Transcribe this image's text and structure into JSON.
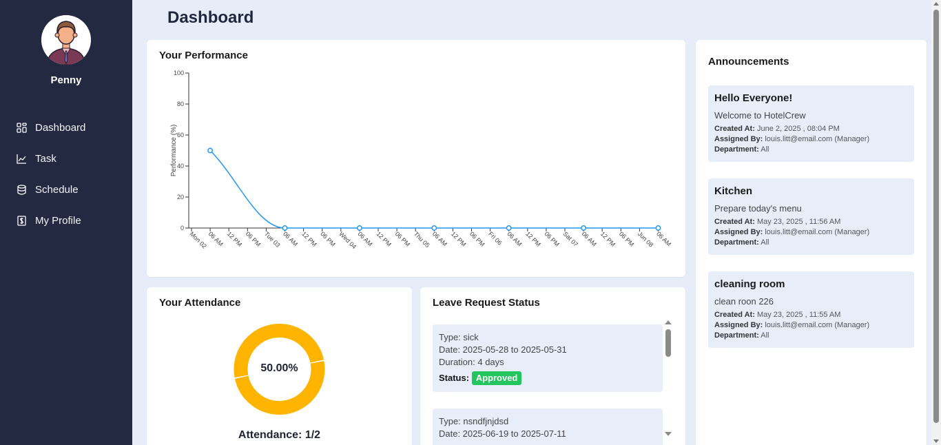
{
  "user": {
    "name": "Penny"
  },
  "sidebar": {
    "items": [
      {
        "label": "Dashboard",
        "icon": "grid-icon"
      },
      {
        "label": "Task",
        "icon": "chart-line-icon"
      },
      {
        "label": "Schedule",
        "icon": "database-icon"
      },
      {
        "label": "My Profile",
        "icon": "dollar-file-icon"
      }
    ]
  },
  "page": {
    "title": "Dashboard"
  },
  "performance": {
    "title": "Your Performance",
    "chart_data": {
      "type": "line",
      "title": "Your Performance",
      "xlabel": "",
      "ylabel": "Performance (%)",
      "ylim": [
        0,
        100
      ],
      "yticks": [
        "0",
        "20",
        "40",
        "60",
        "80",
        "100"
      ],
      "xticks": [
        "Mon 02",
        "06 AM",
        "12 PM",
        "06 PM",
        "Tue 03",
        "06 AM",
        "12 PM",
        "06 PM",
        "Wed 04",
        "06 AM",
        "12 PM",
        "06 PM",
        "Thu 05",
        "06 AM",
        "12 PM",
        "06 PM",
        "Fri 06",
        "06 AM",
        "12 PM",
        "06 PM",
        "Sat 07",
        "06 AM",
        "12 PM",
        "06 PM",
        "Jun 08",
        "06 AM"
      ],
      "points_tick_index": [
        1,
        5,
        9,
        13,
        17,
        21,
        25
      ],
      "values": [
        50,
        0,
        0,
        0,
        0,
        0,
        0
      ],
      "color": "#2196f3",
      "grid": false
    }
  },
  "attendance": {
    "title": "Your Attendance",
    "percent_label": "50.00%",
    "fraction": 0.5,
    "count_label": "Attendance: 1/2",
    "color": "#ffb400"
  },
  "leave": {
    "title": "Leave Request Status",
    "items": [
      {
        "type": "Type: sick",
        "date": "Date: 2025-05-28 to 2025-05-31",
        "duration": "Duration: 4 days",
        "status_label": "Status:",
        "status": "Approved"
      },
      {
        "type": "Type: nsndfjnjdsd",
        "date": "Date: 2025-06-19 to 2025-07-11",
        "duration": "",
        "status_label": "",
        "status": ""
      }
    ]
  },
  "announcements": {
    "title": "Announcements",
    "created_label": "Created At:",
    "assigned_label": "Assigned By:",
    "dept_label": "Department:",
    "items": [
      {
        "title": "Hello Everyone!",
        "desc": "Welcome to HotelCrew",
        "created": "June 2, 2025 , 08:04 PM",
        "assigned": "louis.litt@email.com (Manager)",
        "department": "All"
      },
      {
        "title": "Kitchen",
        "desc": "Prepare today's menu",
        "created": "May 23, 2025 , 11:56 AM",
        "assigned": "louis.litt@email.com (Manager)",
        "department": "All"
      },
      {
        "title": "cleaning room",
        "desc": "clean roon 226",
        "created": "May 23, 2025 , 11:55 AM",
        "assigned": "louis.litt@email.com (Manager)",
        "department": "All"
      }
    ]
  }
}
